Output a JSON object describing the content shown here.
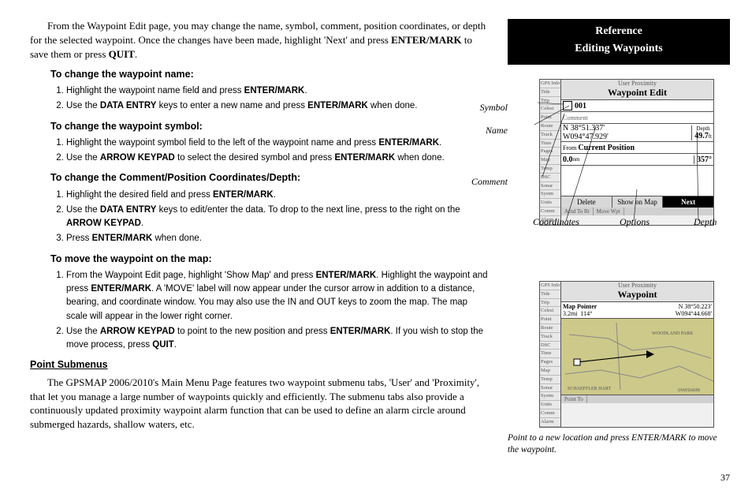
{
  "banner": {
    "ref": "Reference",
    "sub": "Editing Waypoints"
  },
  "intro": {
    "p1": "From the Waypoint Edit page, you may change the name, symbol, comment, position coordinates, or depth for the selected waypoint. Once the changes have been made, highlight 'Next' and press ",
    "p1b1": "ENTER/MARK",
    "p1mid": " to save them or press ",
    "p1b2": "QUIT",
    "p1end": "."
  },
  "sec1": {
    "h": "To change the waypoint name:",
    "s1a": "Highlight the waypoint name field and press ",
    "s1b": "ENTER/MARK",
    "s1c": ".",
    "s2a": "Use the ",
    "s2b": "DATA ENTRY",
    "s2c": " keys to enter a new name and press ",
    "s2d": "ENTER/MARK",
    "s2e": " when done."
  },
  "sec2": {
    "h": "To change the waypoint symbol:",
    "s1a": "Highlight the waypoint symbol field to the left of the waypoint name and press ",
    "s1b": "ENTER/MARK",
    "s1c": ".",
    "s2a": "Use the ",
    "s2b": "ARROW KEYPAD",
    "s2c": " to select the desired symbol and press ",
    "s2d": "ENTER/MARK",
    "s2e": " when done."
  },
  "sec3": {
    "h": "To change the Comment/Position Coordinates/Depth:",
    "s1a": "Highlight the desired field and press ",
    "s1b": "ENTER/MARK",
    "s1c": ".",
    "s2a": "Use the ",
    "s2b": "DATA ENTRY",
    "s2c": " keys to edit/enter the data. To drop to the next line, press to the right on the ",
    "s2d": "ARROW KEYPAD",
    "s2e": ".",
    "s3a": "Press ",
    "s3b": "ENTER/MARK",
    "s3c": " when done."
  },
  "sec4": {
    "h": "To move the waypoint on the map:",
    "s1a": "From the Waypoint Edit page, highlight 'Show Map' and press ",
    "s1b": "ENTER/MARK",
    "s1c": ". Highlight the waypoint and press ",
    "s1d": "ENTER/MARK",
    "s1e": ". A 'MOVE' label will now appear under the cursor arrow in addition to a distance, bearing, and coordinate window. You may also use the IN and OUT keys to zoom the map. The map scale will appear in the lower right corner.",
    "s2a": "Use the ",
    "s2b": "ARROW KEYPAD",
    "s2c": " to point to the new position and press ",
    "s2d": "ENTER/MARK",
    "s2e": ". If you wish to stop the move process, press ",
    "s2f": "QUIT",
    "s2g": "."
  },
  "sec5": {
    "h": "Point Submenus",
    "p1": "The GPSMAP 2006/2010's Main Menu Page features two waypoint submenu tabs, 'User' and 'Proximity', that let you manage a large number of waypoints quickly and efficiently. The submenu tabs also provide a continuously updated proximity waypoint alarm function that can be used to define an alarm circle around submerged hazards, shallow waters, etc."
  },
  "fig1": {
    "tabs": [
      "GPS Info",
      "Tide",
      "Trip",
      "Celest",
      "Point",
      "Route",
      "Track",
      "Time",
      "Pages",
      "Map",
      "Temp",
      "DSC",
      "Sonar",
      "Systm",
      "Units",
      "Comm",
      "Alarm"
    ],
    "pretitle": "User  Proximity",
    "title": "Waypoint Edit",
    "name": "001",
    "commentLabel": "Comment",
    "lat": "N  38°51.337'",
    "lon": "W094°47.929'",
    "depthLabel": "Depth",
    "depth": "49.7",
    "depthUnit": "ft",
    "fromLabel": "From",
    "from": "Current Position",
    "dist": "0.0",
    "distUnit": "nm",
    "brg": "357°",
    "btnDelete": "Delete",
    "btnShow": "Show on Map",
    "btnNext": "Next",
    "soft1": "Arnd To Rt",
    "soft2": "Move Wpt",
    "labSymbol": "Symbol",
    "labName": "Name",
    "labComment": "Comment",
    "labCoords": "Coordinates",
    "labOptions": "Options",
    "labDepth": "Depth"
  },
  "fig2": {
    "tabs": [
      "GPS Info",
      "Tide",
      "Trip",
      "Celest",
      "Point",
      "Route",
      "Track",
      "DSC",
      "Time",
      "Pages",
      "Map",
      "Temp",
      "Sonar",
      "Systm",
      "Units",
      "Comm",
      "Alarm"
    ],
    "pretitle": "User  Proximity",
    "title": "Waypoint",
    "pointer": "Map Pointer",
    "dist": "3.2mi",
    "brg": "114°",
    "lat": "N  38°50.223'",
    "lon": "W094°44.668'",
    "scale": "overzoom",
    "soft": "Point To",
    "caption": "Point to a new location and press ENTER/MARK to move the waypoint."
  },
  "pageNumber": "37"
}
